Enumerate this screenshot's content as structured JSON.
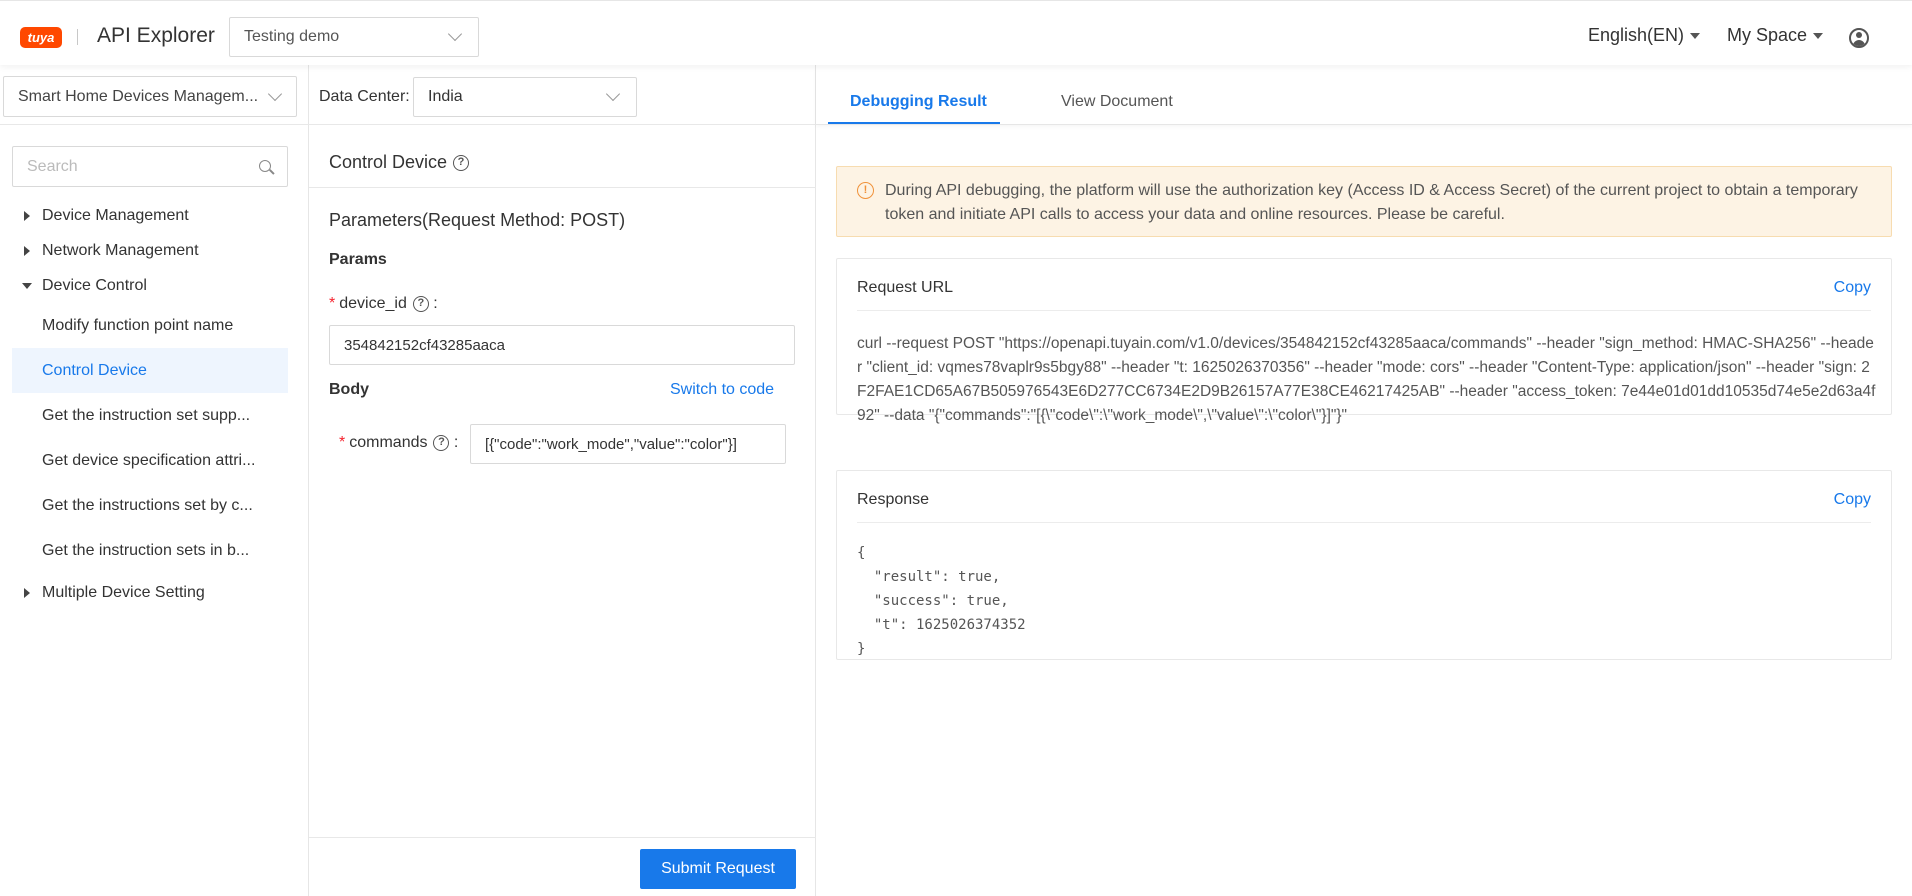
{
  "header": {
    "logo_text": "tuya",
    "app_title": "API Explorer",
    "project": "Testing demo",
    "language": "English(EN)",
    "space": "My Space"
  },
  "sidebar": {
    "category": "Smart Home Devices Managem...",
    "search_placeholder": "Search",
    "items": [
      {
        "label": "Device Management",
        "expanded": false
      },
      {
        "label": "Network Management",
        "expanded": false
      },
      {
        "label": "Device Control",
        "expanded": true
      },
      {
        "label": "Multiple Device Setting",
        "expanded": false
      }
    ],
    "children": [
      {
        "label": "Modify function point name",
        "active": false
      },
      {
        "label": "Control Device",
        "active": true
      },
      {
        "label": "Get the instruction set supp...",
        "active": false
      },
      {
        "label": "Get device specification attri...",
        "active": false
      },
      {
        "label": "Get the instructions set by c...",
        "active": false
      },
      {
        "label": "Get the instruction sets in b...",
        "active": false
      }
    ]
  },
  "middle": {
    "data_center_label": "Data Center:",
    "data_center": "India",
    "api_title": "Control Device",
    "params_title": "Parameters(Request Method: POST)",
    "params_label": "Params",
    "device_id_label": "device_id",
    "device_id_value": "354842152cf43285aaca",
    "body_label": "Body",
    "switch_code": "Switch to code",
    "commands_label": "commands",
    "commands_value": "[{\"code\":\"work_mode\",\"value\":\"color\"}]",
    "submit": "Submit Request"
  },
  "right": {
    "tabs": [
      "Debugging Result",
      "View Document"
    ],
    "alert": "During API debugging, the platform will use the authorization key (Access ID & Access Secret) of the current project to obtain a temporary token and initiate API calls to access your data and online resources. Please be careful.",
    "request_url_title": "Request URL",
    "copy_label": "Copy",
    "request_url": "curl --request POST \"https://openapi.tuyain.com/v1.0/devices/354842152cf43285aaca/commands\" --header \"sign_method: HMAC-SHA256\" --header \"client_id: vqmes78vaplr9s5bgy88\" --header \"t: 1625026370356\" --header \"mode: cors\" --header \"Content-Type: application/json\" --header \"sign: 2F2FAE1CD65A67B505976543E6D277CC6734E2D9B26157A77E38CE46217425AB\" --header \"access_token: 7e44e01d01dd10535d74e5e2d63a4f92\" --data \"{\"commands\":\"[{\\\"code\\\":\\\"work_mode\\\",\\\"value\\\":\\\"color\\\"}]\"}\"",
    "response_title": "Response",
    "response": "{\n  \"result\": true,\n  \"success\": true,\n  \"t\": 1625026374352\n}"
  },
  "colors": {
    "accent": "#1879ea",
    "brand": "#ff4800",
    "warning": "#f0923a",
    "required": "#f5222d"
  }
}
